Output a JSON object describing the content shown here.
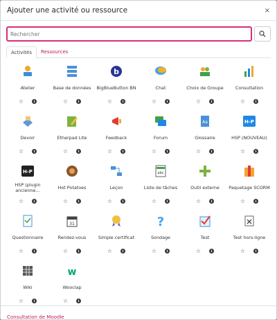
{
  "modal": {
    "title": "Ajouter une activité ou ressource",
    "close": "×"
  },
  "search": {
    "placeholder": "Rechercher",
    "icon": "search-icon"
  },
  "tabs": [
    {
      "label": "Activités"
    },
    {
      "label": "Ressources"
    }
  ],
  "items": [
    {
      "label": "Atelier",
      "icon": "workshop-icon"
    },
    {
      "label": "Base de données",
      "icon": "database-icon"
    },
    {
      "label": "BigBlueButton BN",
      "icon": "bigbluebutton-icon"
    },
    {
      "label": "Chat",
      "icon": "chat-icon"
    },
    {
      "label": "Choix de Groupe",
      "icon": "group-choice-icon"
    },
    {
      "label": "Consultation",
      "icon": "consultation-icon"
    },
    {
      "label": "Devoir",
      "icon": "assignment-icon"
    },
    {
      "label": "Etherpad Lite",
      "icon": "etherpad-icon"
    },
    {
      "label": "Feedback",
      "icon": "feedback-icon"
    },
    {
      "label": "Forum",
      "icon": "forum-icon"
    },
    {
      "label": "Glossaire",
      "icon": "glossary-icon"
    },
    {
      "label": "HSP (NOUVEAU)",
      "icon": "h5p-icon"
    },
    {
      "label": "HSP (plugin ancienne…",
      "icon": "h5p-legacy-icon"
    },
    {
      "label": "Hot Potatoes",
      "icon": "hotpotatoes-icon"
    },
    {
      "label": "Leçon",
      "icon": "lesson-icon"
    },
    {
      "label": "Liste de tâches",
      "icon": "checklist-icon"
    },
    {
      "label": "Outil externe",
      "icon": "external-tool-icon"
    },
    {
      "label": "Paquetage SCORM",
      "icon": "scorm-icon"
    },
    {
      "label": "Questionnaire",
      "icon": "questionnaire-icon"
    },
    {
      "label": "Rendez-vous",
      "icon": "calendar-icon"
    },
    {
      "label": "Simple certificat",
      "icon": "certificate-icon"
    },
    {
      "label": "Sondage",
      "icon": "survey-icon"
    },
    {
      "label": "Test",
      "icon": "quiz-icon"
    },
    {
      "label": "Test hors-ligne",
      "icon": "offline-quiz-icon"
    },
    {
      "label": "Wiki",
      "icon": "wiki-icon"
    },
    {
      "label": "Wooclap",
      "icon": "wooclap-icon"
    }
  ],
  "actions": {
    "star": "☆",
    "info": "i"
  },
  "footer": {
    "text": "Consultation de Moodle"
  },
  "colors": {
    "accent": "#d4317a",
    "link": "#c2185b",
    "dark": "#343a40"
  }
}
